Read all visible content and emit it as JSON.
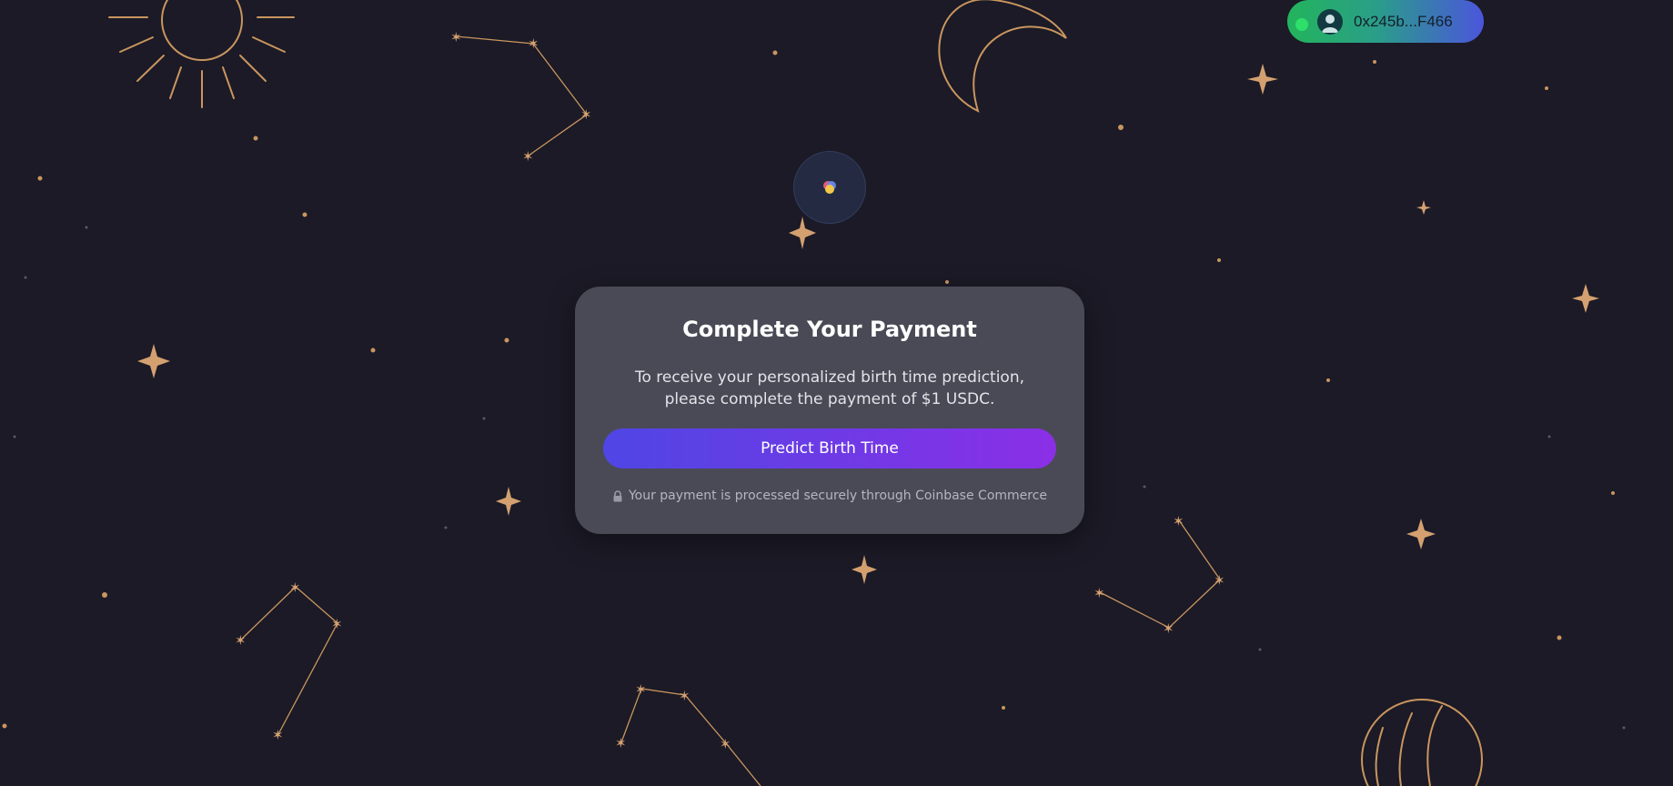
{
  "wallet": {
    "address": "0x245b...F466",
    "status": "connected",
    "gradient": [
      "#23b45c",
      "#4b55dc"
    ]
  },
  "payment_modal": {
    "title": "Complete Your Payment",
    "description": "To receive your personalized birth time prediction, please complete the payment of $1 USDC.",
    "button_label": "Predict Birth Time",
    "secure_note": "Your payment is processed securely through Coinbase Commerce",
    "lock_icon": "lock-icon"
  },
  "theme": {
    "background": "#1b1a26",
    "gold": "#c9955f",
    "button_gradient": [
      "#4f46e5",
      "#8b2fe6"
    ]
  },
  "decorations": [
    "sun-icon",
    "moon-icon",
    "planet-icon",
    "constellation",
    "sparkle-star"
  ]
}
